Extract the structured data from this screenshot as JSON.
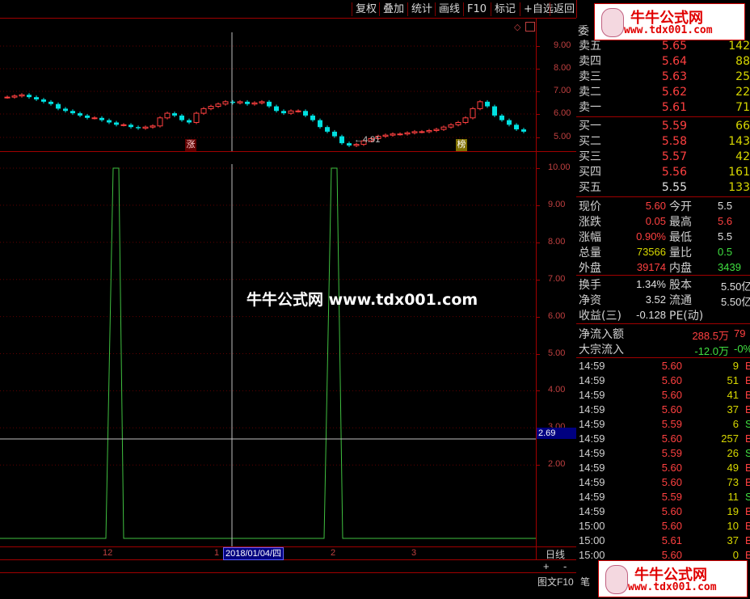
{
  "toolbar": {
    "buttons": [
      "复权",
      "叠加",
      "统计",
      "画线",
      "F10",
      "标记",
      "+自选",
      "返回"
    ]
  },
  "upper_chart": {
    "y_ticks": [
      "9.00",
      "8.00",
      "7.00",
      "6.00",
      "5.00"
    ],
    "low_price_label": "←4.91",
    "markers": [
      "涨",
      "榜"
    ]
  },
  "lower_chart": {
    "y_ticks": [
      "10.00",
      "9.00",
      "8.00",
      "7.00",
      "6.00",
      "5.00",
      "4.00",
      "3.00",
      "2.00"
    ],
    "cursor_value": "2.69",
    "x_ticks": [
      "12",
      "1",
      "2",
      "3"
    ],
    "date_label": "2018/01/04/四",
    "period_label": "日线",
    "zoom_in": "+",
    "zoom_out": "-",
    "bottom_tab": "图文F10"
  },
  "watermark": {
    "text": "牛牛公式网 www.tdx001.com"
  },
  "logo": {
    "name": "牛牛公式网",
    "url": "www.tdx001.com"
  },
  "order_book": {
    "title_fragment": "委",
    "asks": [
      {
        "label": "卖五",
        "price": "5.65",
        "volume": "142"
      },
      {
        "label": "卖四",
        "price": "5.64",
        "volume": "88"
      },
      {
        "label": "卖三",
        "price": "5.63",
        "volume": "25"
      },
      {
        "label": "卖二",
        "price": "5.62",
        "volume": "22"
      },
      {
        "label": "卖一",
        "price": "5.61",
        "volume": "71"
      }
    ],
    "bids": [
      {
        "label": "买一",
        "price": "5.59",
        "volume": "66"
      },
      {
        "label": "买二",
        "price": "5.58",
        "volume": "143"
      },
      {
        "label": "买三",
        "price": "5.57",
        "volume": "42"
      },
      {
        "label": "买四",
        "price": "5.56",
        "volume": "161"
      },
      {
        "label": "买五",
        "price": "5.55",
        "volume": "133"
      }
    ]
  },
  "quote": {
    "rows": [
      {
        "l1": "现价",
        "v1": "5.60",
        "c1": "#ff4040",
        "l2": "今开",
        "v2": "5.5"
      },
      {
        "l1": "涨跌",
        "v1": "0.05",
        "c1": "#ff4040",
        "l2": "最高",
        "v2": "5.6"
      },
      {
        "l1": "涨幅",
        "v1": "0.90%",
        "c1": "#ff4040",
        "l2": "最低",
        "v2": "5.5"
      },
      {
        "l1": "总量",
        "v1": "73566",
        "c1": "#d8d800",
        "l2": "量比",
        "v2": "0.5"
      },
      {
        "l1": "外盘",
        "v1": "39174",
        "c1": "#ff4040",
        "l2": "内盘",
        "v2": "3439"
      }
    ],
    "rows2": [
      {
        "l1": "换手",
        "v1": "1.34%",
        "l2": "股本",
        "v2": "5.50亿"
      },
      {
        "l1": "净资",
        "v1": "3.52",
        "l2": "流通",
        "v2": "5.50亿"
      },
      {
        "l1": "收益(三)",
        "v1": "-0.128",
        "l2": "PE(动)",
        "v2": ""
      }
    ],
    "flow": [
      {
        "label": "净流入额",
        "value": "288.5万",
        "extra": "79"
      },
      {
        "label": "大宗流入",
        "value": "-12.0万",
        "extra": "-0%"
      }
    ]
  },
  "ticks": [
    {
      "time": "14:59",
      "price": "5.60",
      "vol": "9",
      "dir": "B"
    },
    {
      "time": "14:59",
      "price": "5.60",
      "vol": "51",
      "dir": "B"
    },
    {
      "time": "14:59",
      "price": "5.60",
      "vol": "41",
      "dir": "B"
    },
    {
      "time": "14:59",
      "price": "5.60",
      "vol": "37",
      "dir": "B"
    },
    {
      "time": "14:59",
      "price": "5.59",
      "vol": "6",
      "dir": "S"
    },
    {
      "time": "14:59",
      "price": "5.60",
      "vol": "257",
      "dir": "B"
    },
    {
      "time": "14:59",
      "price": "5.59",
      "vol": "26",
      "dir": "S"
    },
    {
      "time": "14:59",
      "price": "5.60",
      "vol": "49",
      "dir": "B"
    },
    {
      "time": "14:59",
      "price": "5.60",
      "vol": "73",
      "dir": "B"
    },
    {
      "time": "14:59",
      "price": "5.59",
      "vol": "11",
      "dir": "S"
    },
    {
      "time": "14:59",
      "price": "5.60",
      "vol": "19",
      "dir": "B"
    },
    {
      "time": "15:00",
      "price": "5.60",
      "vol": "10",
      "dir": "B"
    },
    {
      "time": "15:00",
      "price": "5.61",
      "vol": "37",
      "dir": "B"
    },
    {
      "time": "15:00",
      "price": "5.60",
      "vol": "0",
      "dir": "B"
    }
  ],
  "panel_bottom_tab": "笔",
  "colors": {
    "frame": "#a00000",
    "up": "#ff4040",
    "down": "#00e0e0",
    "indicator": "#40c040",
    "cursor": "#c0c0c0"
  }
}
